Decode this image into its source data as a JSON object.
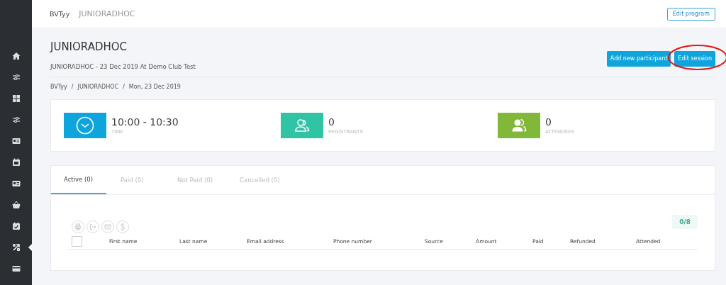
{
  "sidebar": {
    "items": [
      {
        "selected": false
      },
      {
        "selected": false
      },
      {
        "selected": false
      },
      {
        "selected": false
      },
      {
        "selected": false
      },
      {
        "selected": false
      },
      {
        "selected": false
      },
      {
        "selected": false
      },
      {
        "selected": false
      },
      {
        "selected": true
      },
      {
        "selected": false
      }
    ]
  },
  "topbar": {
    "crumbs": [
      "BVTyy",
      "JUNIORADHOC"
    ],
    "button": "Edit program"
  },
  "header": {
    "title": "JUNIORADHOC",
    "subtitle": "JUNIORADHOC - 23 Dec 2019 At Demo Club Test",
    "buttons": [
      {
        "label": "Add new participant",
        "highlighted": false
      },
      {
        "label": "Edit session",
        "highlighted": true
      }
    ],
    "breadcrumb": [
      "BVTyy",
      "JUNIORADHOC",
      "Mon, 23 Dec 2019"
    ],
    "breadcrumb_separator": "/"
  },
  "stats": [
    {
      "kind": "time",
      "value": "10:00 - 10:30",
      "label": "TIME",
      "color": "#0ea5dc"
    },
    {
      "kind": "registrants",
      "value": "0",
      "label": "REGISTRANTS",
      "color": "#2ec4a4"
    },
    {
      "kind": "attendees",
      "value": "0",
      "label": "ATTENDEES",
      "color": "#82b83a"
    }
  ],
  "tabs": [
    {
      "label": "Active (0)",
      "selected": true
    },
    {
      "label": "Paid (0)",
      "selected": false
    },
    {
      "label": "Not Paid (0)",
      "selected": false
    },
    {
      "label": "Cancelled (0)",
      "selected": false
    }
  ],
  "count": "0/8",
  "table": {
    "select_all": {
      "checked": false
    },
    "columns": [
      "First name",
      "Last name",
      "Email address",
      "Phone number",
      "Source",
      "Amount",
      "Paid",
      "Refunded",
      "Attended"
    ]
  }
}
